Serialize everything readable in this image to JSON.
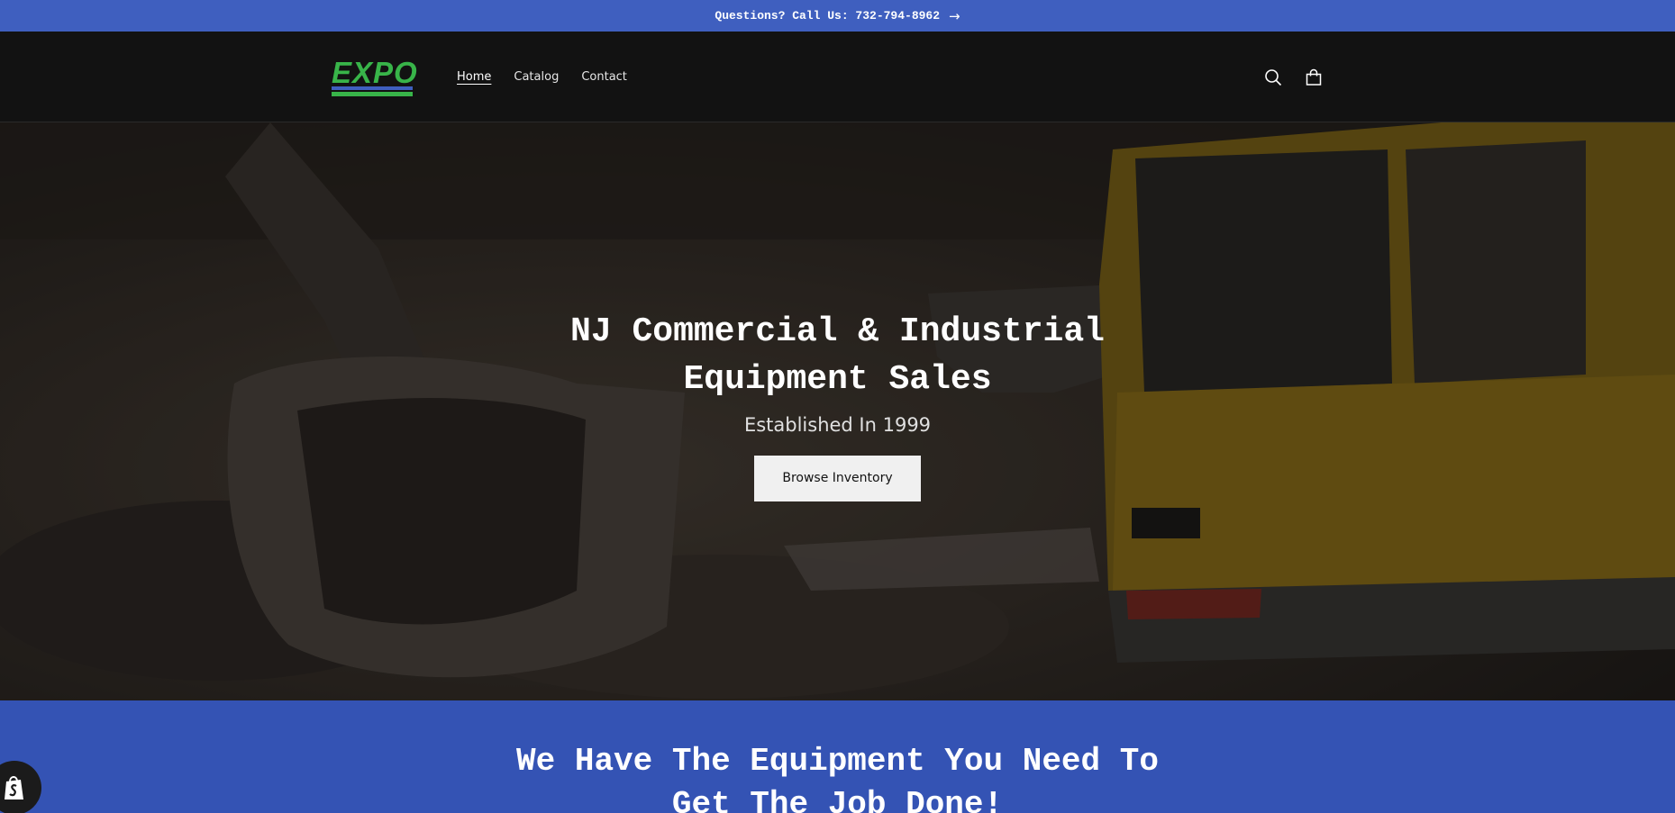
{
  "announcement": {
    "text": "Questions? Call Us: 732-794-8962",
    "arrow_icon": "arrow-right-icon"
  },
  "header": {
    "logo_text": "EXPO",
    "nav": [
      {
        "label": "Home",
        "active": true
      },
      {
        "label": "Catalog",
        "active": false
      },
      {
        "label": "Contact",
        "active": false
      }
    ],
    "icons": [
      "search-icon",
      "cart-icon"
    ]
  },
  "hero": {
    "title": "NJ Commercial & Industrial Equipment Sales",
    "subtitle": "Established In 1999",
    "button_label": "Browse Inventory"
  },
  "section": {
    "heading": "We Have The Equipment You Need To Get The Job Done!"
  },
  "colors": {
    "accent_blue": "#3f5fbf",
    "section_blue": "#3453b4",
    "brand_green": "#38b449",
    "header_bg": "#121212"
  }
}
